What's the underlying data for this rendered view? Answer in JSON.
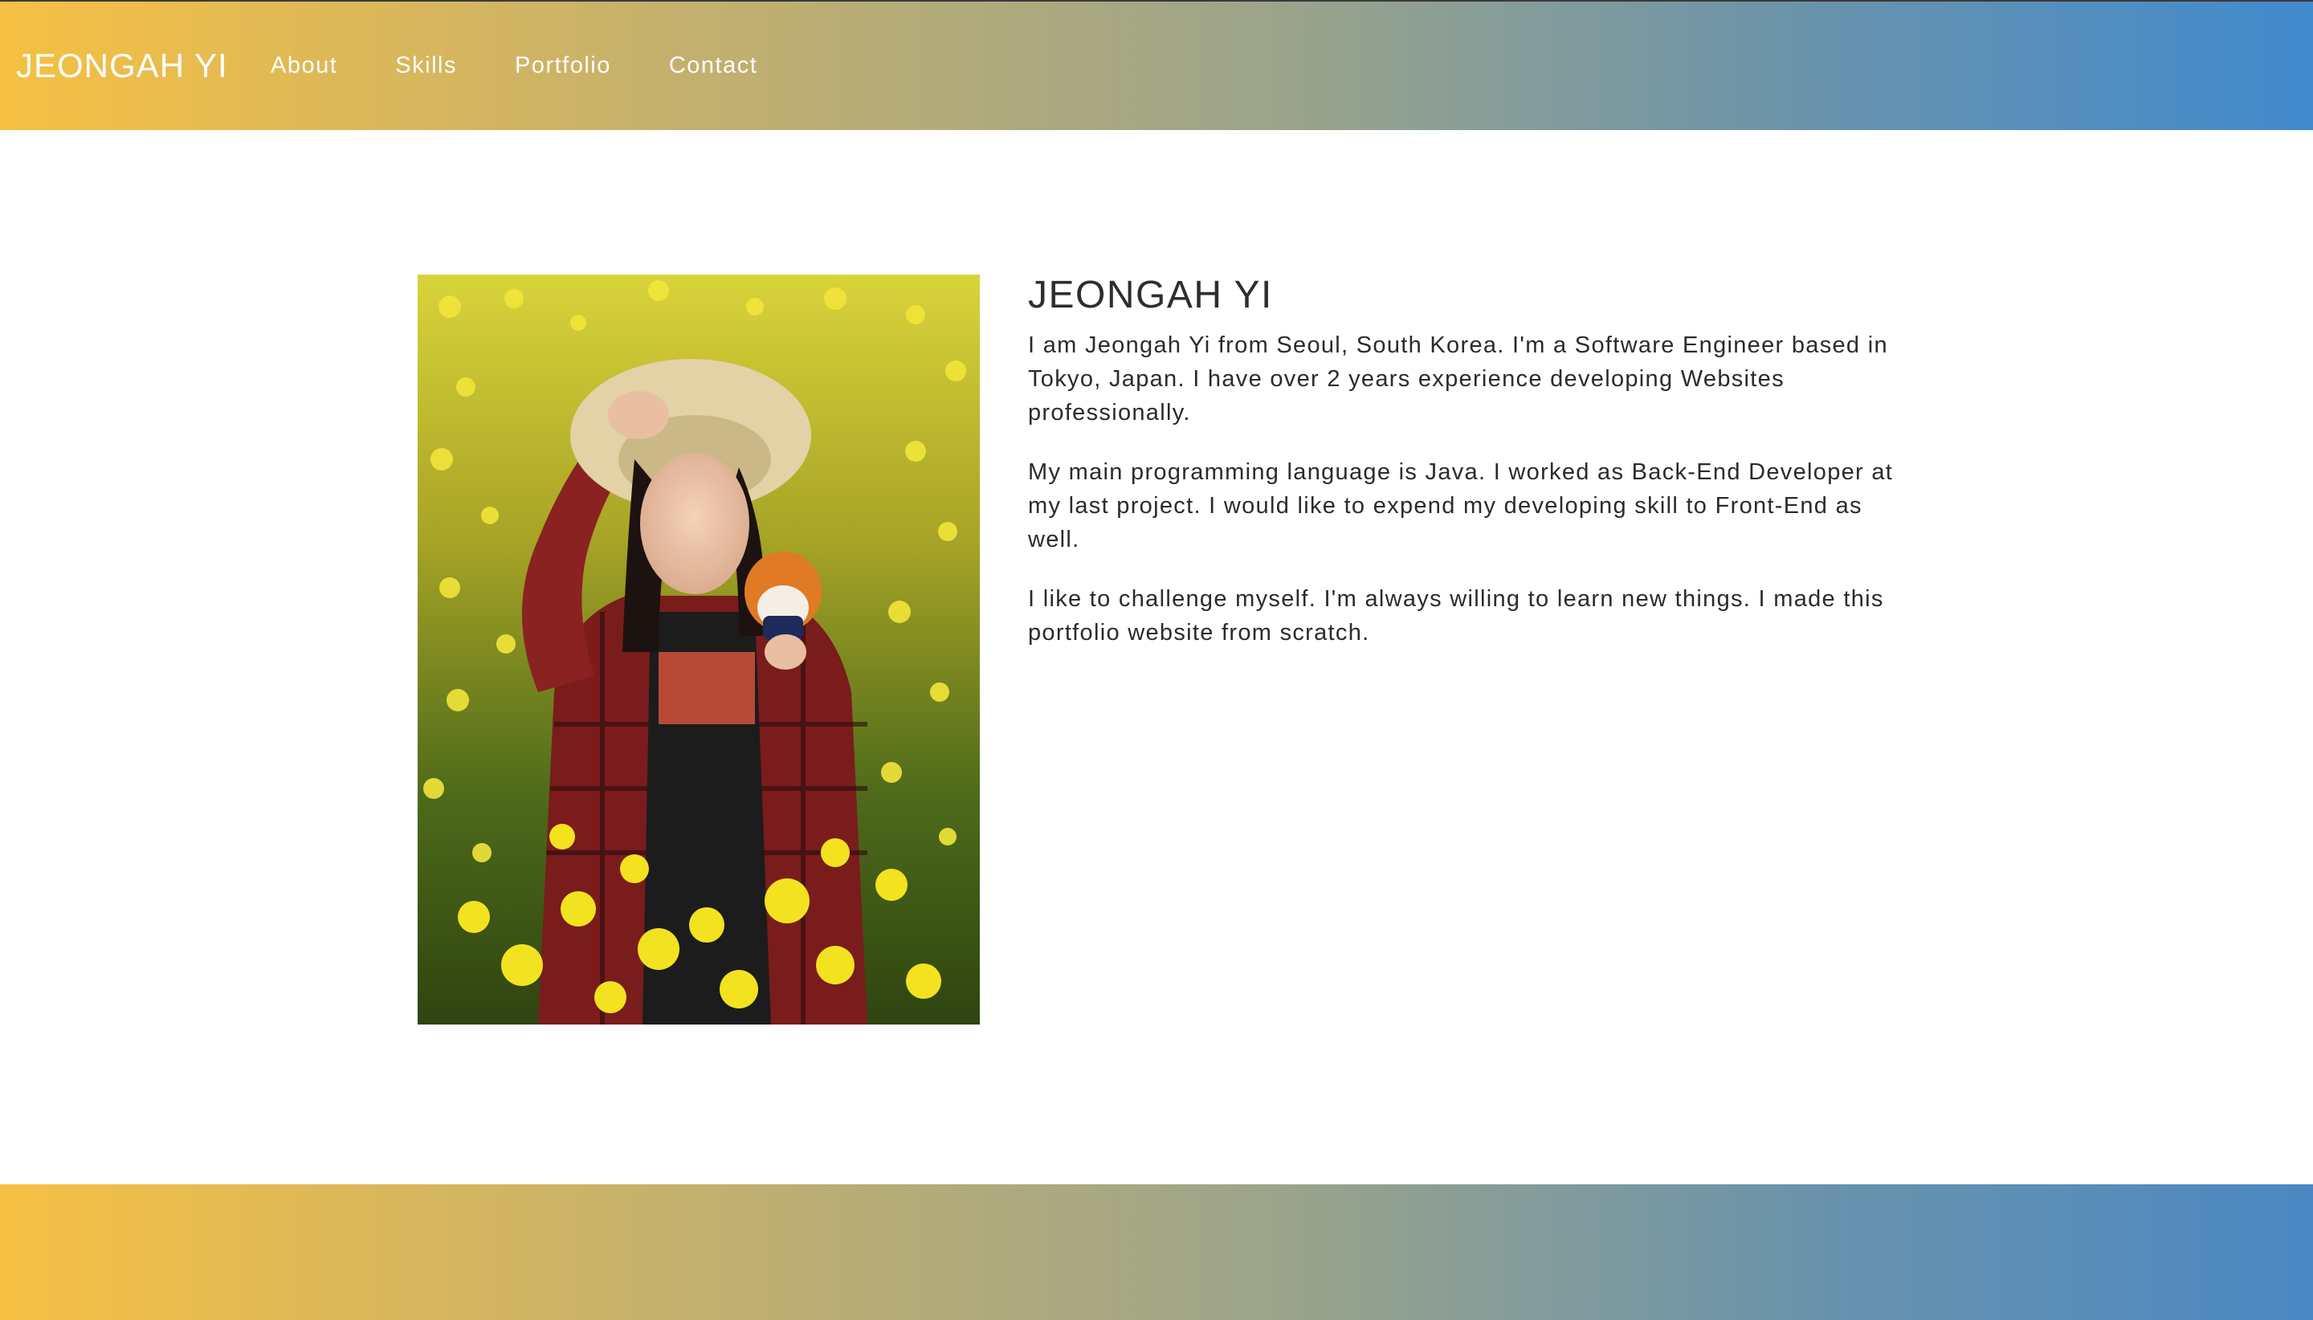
{
  "header": {
    "brand": "JEONGAH YI",
    "nav": [
      {
        "label": "About"
      },
      {
        "label": "Skills"
      },
      {
        "label": "Portfolio"
      },
      {
        "label": "Contact"
      }
    ]
  },
  "about": {
    "name": "JEONGAH YI",
    "paragraphs": [
      "I am Jeongah Yi from Seoul, South Korea. I'm a Software Engineer based in Tokyo, Japan. I have over 2 years experience developing Websites professionally.",
      "My main programming language is Java. I worked as Back-End Developer at my last project. I would like to expend my developing skill to Front-End as well.",
      "I like to challenge myself. I'm always willing to learn new things. I made this portfolio website from scratch."
    ]
  },
  "colors": {
    "gradient_start": "#f6c043",
    "gradient_end": "#418ace",
    "text": "#2b2b2b"
  }
}
